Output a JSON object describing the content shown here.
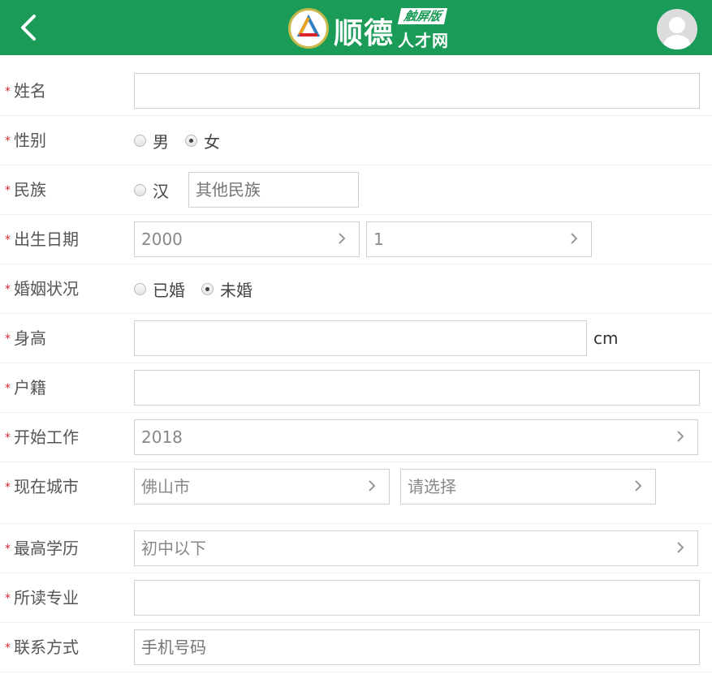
{
  "header": {
    "logo_name": "顺德",
    "logo_badge": "触屏版",
    "logo_sub": "人才网",
    "brand_color": "#1a9b57"
  },
  "form": {
    "name": {
      "label": "姓名",
      "value": ""
    },
    "gender": {
      "label": "性别",
      "options": [
        "男",
        "女"
      ],
      "selected": "女"
    },
    "ethnicity": {
      "label": "民族",
      "option": "汉",
      "other_placeholder": "其他民族"
    },
    "birth": {
      "label": "出生日期",
      "year": "2000",
      "month": "1"
    },
    "marital": {
      "label": "婚姻状况",
      "options": [
        "已婚",
        "未婚"
      ],
      "selected": "未婚"
    },
    "height": {
      "label": "身高",
      "value": "",
      "unit": "cm"
    },
    "hukou": {
      "label": "户籍",
      "value": ""
    },
    "work_start": {
      "label": "开始工作",
      "value": "2018"
    },
    "city": {
      "label": "现在城市",
      "city": "佛山市",
      "district": "请选择"
    },
    "education": {
      "label": "最高学历",
      "value": "初中以下"
    },
    "major": {
      "label": "所读专业",
      "value": ""
    },
    "contact": {
      "label": "联系方式",
      "placeholder": "手机号码"
    }
  },
  "required_mark": "*"
}
